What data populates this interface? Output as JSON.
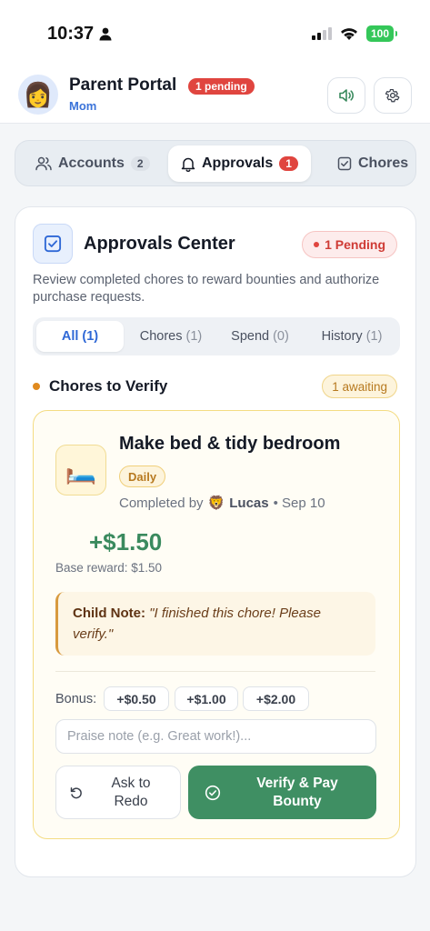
{
  "status_bar": {
    "time": "10:37",
    "battery": "100"
  },
  "header": {
    "title": "Parent Portal",
    "pending_pill": "1 pending",
    "subtitle": "Mom",
    "avatar_emoji": "👩",
    "sound_icon": "speaker-icon",
    "settings_icon": "gear-icon"
  },
  "tabs": [
    {
      "label": "Accounts",
      "count": "2",
      "icon": "users-icon"
    },
    {
      "label": "Approvals",
      "count": "1",
      "icon": "bell-icon"
    },
    {
      "label": "Chores",
      "icon": "checkbox-icon"
    }
  ],
  "approvals": {
    "title": "Approvals Center",
    "pending_badge": "1 Pending",
    "description": "Review completed chores to reward bounties and authorize purchase requests.",
    "filters": [
      {
        "label": "All",
        "count": "(1)"
      },
      {
        "label": "Chores",
        "count": "(1)"
      },
      {
        "label": "Spend",
        "count": "(0)"
      },
      {
        "label": "History",
        "count": "(1)"
      }
    ],
    "section_title": "Chores to Verify",
    "awaiting_badge": "1 awaiting"
  },
  "chore": {
    "emoji": "🛏️",
    "title": "Make bed & tidy bedroom",
    "frequency": "Daily",
    "completed_prefix": "Completed by",
    "child_emoji": "🦁",
    "child_name": "Lucas",
    "date": "• Sep 10",
    "amount": "+$1.50",
    "base_reward": "Base reward: $1.50",
    "note_label": "Child Note:",
    "note_text": "\"I finished this chore! Please verify.\"",
    "bonus_label": "Bonus:",
    "bonus_options": [
      "+$0.50",
      "+$1.00",
      "+$2.00"
    ],
    "praise_placeholder": "Praise note (e.g. Great work!)...",
    "redo_label": "Ask to Redo",
    "pay_label": "Verify & Pay Bounty"
  },
  "colors": {
    "accent_blue": "#2f68d6",
    "pending_red": "#e0453f",
    "success_green": "#3f8f63",
    "amber": "#b7791f"
  }
}
